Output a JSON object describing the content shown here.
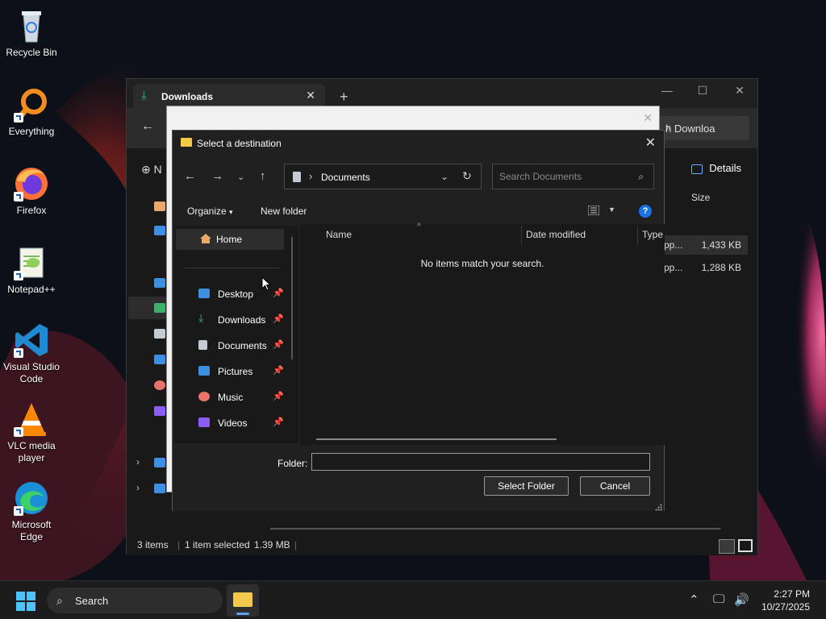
{
  "desktop": {
    "icons": [
      {
        "label": "Recycle Bin",
        "icon": "recycle-bin-icon"
      },
      {
        "label": "Everything",
        "icon": "everything-icon"
      },
      {
        "label": "Firefox",
        "icon": "firefox-icon"
      },
      {
        "label": "Notepad++",
        "icon": "notepad-plus-plus-icon"
      },
      {
        "label": "Visual Studio Code",
        "icon": "vscode-icon"
      },
      {
        "label": "VLC media player",
        "icon": "vlc-icon"
      },
      {
        "label": "Microsoft Edge",
        "icon": "edge-icon"
      }
    ]
  },
  "explorer": {
    "tab_title": "Downloads",
    "search_placeholder": "h Downloa",
    "new_label": "N",
    "details_label": "Details",
    "size_header": "Size",
    "rows": [
      {
        "type": "pp...",
        "size": "1,433 KB",
        "selected": true
      },
      {
        "type": "pp...",
        "size": "1,288 KB",
        "selected": false
      }
    ],
    "status": {
      "items": "3 items",
      "selected": "1 item selected",
      "size": "1.39 MB"
    }
  },
  "dialog": {
    "title": "Select a destination",
    "path": "Documents",
    "search_placeholder": "Search Documents",
    "toolbar": {
      "organize": "Organize",
      "new_folder": "New folder"
    },
    "nav": {
      "home": "Home",
      "items": [
        {
          "label": "Desktop",
          "color": "#3d8fe0"
        },
        {
          "label": "Downloads",
          "color": "#3fb06a"
        },
        {
          "label": "Documents",
          "color": "#c5cbd3"
        },
        {
          "label": "Pictures",
          "color": "#3d8fe0"
        },
        {
          "label": "Music",
          "color": "#e9736b"
        },
        {
          "label": "Videos",
          "color": "#8b5cf6"
        }
      ]
    },
    "columns": {
      "name": "Name",
      "date_modified": "Date modified",
      "type": "Type"
    },
    "empty_message": "No items match your search.",
    "folder_label": "Folder:",
    "folder_value": "",
    "select_button": "Select Folder",
    "cancel_button": "Cancel"
  },
  "taskbar": {
    "search_label": "Search",
    "time": "2:27 PM",
    "date": "10/27/2025"
  }
}
